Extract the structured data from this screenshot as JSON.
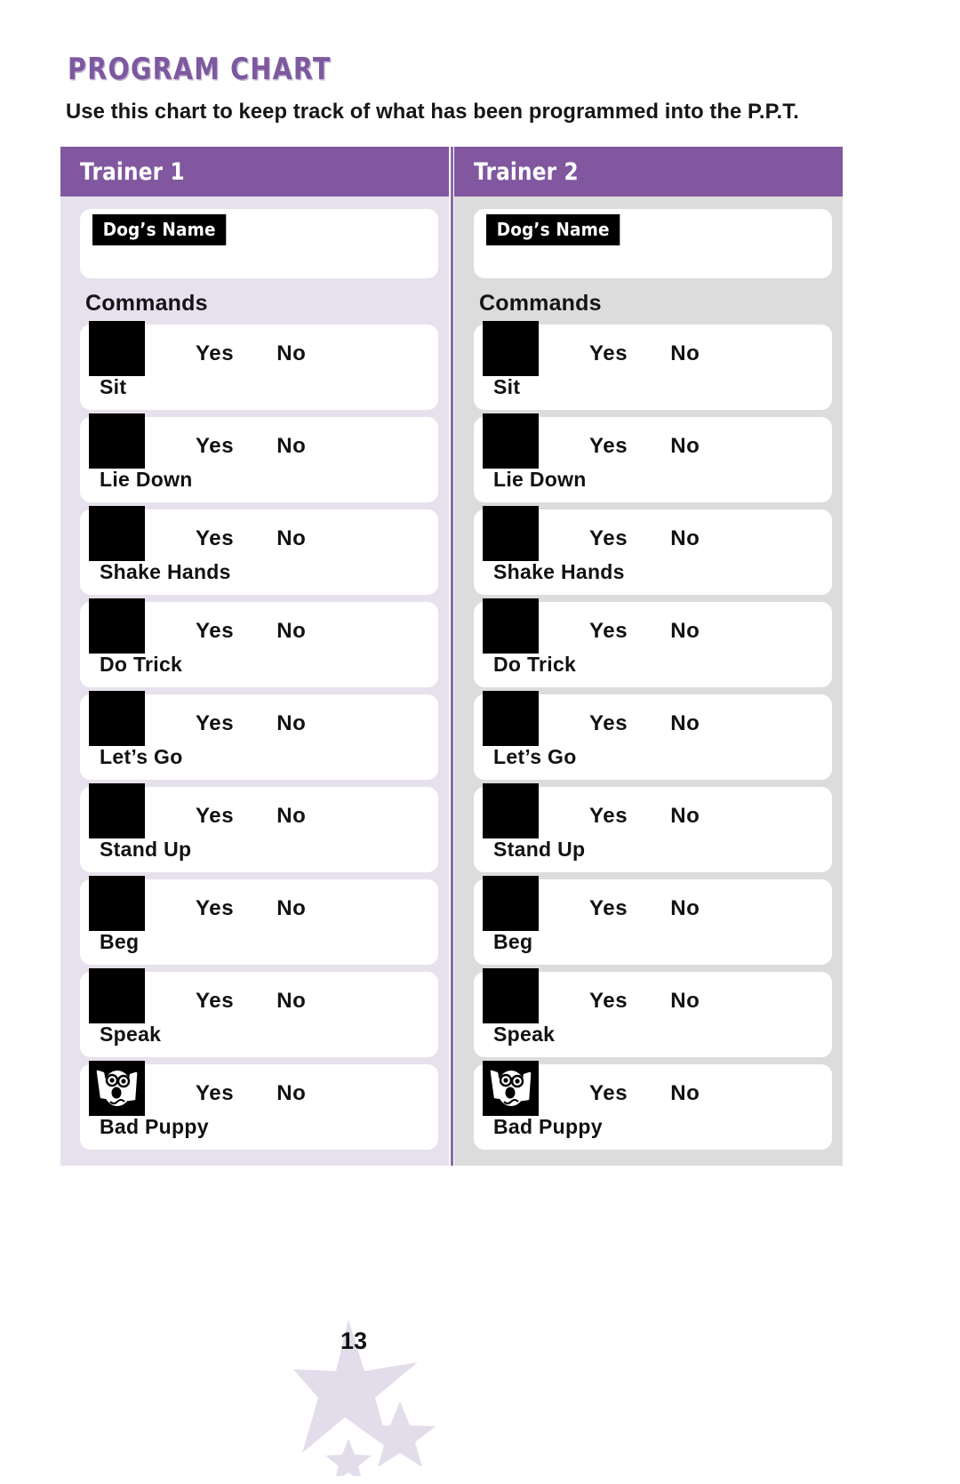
{
  "header": {
    "title": "PROGRAM CHART",
    "subtitle": "Use this chart to keep track of what has been programmed into the P.P.T."
  },
  "colors": {
    "title_purple": "#7d59a0",
    "header_bar_purple": "#81579f",
    "divider_purple": "#8e6aa8",
    "left_panel_bg": "#e7e1ed",
    "right_panel_bg": "#dcdcdc",
    "swatch_black": "#000000",
    "star_lavender": "#e3dcea"
  },
  "labels": {
    "dogs_name": "Dog’s Name",
    "commands": "Commands",
    "yes": "Yes",
    "no": "No"
  },
  "commands": [
    {
      "name": "Sit",
      "icon": "black-swatch"
    },
    {
      "name": "Lie Down",
      "icon": "black-swatch"
    },
    {
      "name": "Shake Hands",
      "icon": "black-swatch"
    },
    {
      "name": "Do Trick",
      "icon": "black-swatch"
    },
    {
      "name": "Let’s Go",
      "icon": "black-swatch"
    },
    {
      "name": "Stand Up",
      "icon": "black-swatch"
    },
    {
      "name": "Beg",
      "icon": "black-swatch"
    },
    {
      "name": "Speak",
      "icon": "black-swatch"
    },
    {
      "name": "Bad Puppy",
      "icon": "dog-face-icon"
    }
  ],
  "columns": [
    {
      "title": "Trainer 1",
      "dogs_name_value": "",
      "tone": "tone-lavender"
    },
    {
      "title": "Trainer 2",
      "dogs_name_value": "",
      "tone": "tone-gray"
    }
  ],
  "footer": {
    "page_number": "13"
  }
}
